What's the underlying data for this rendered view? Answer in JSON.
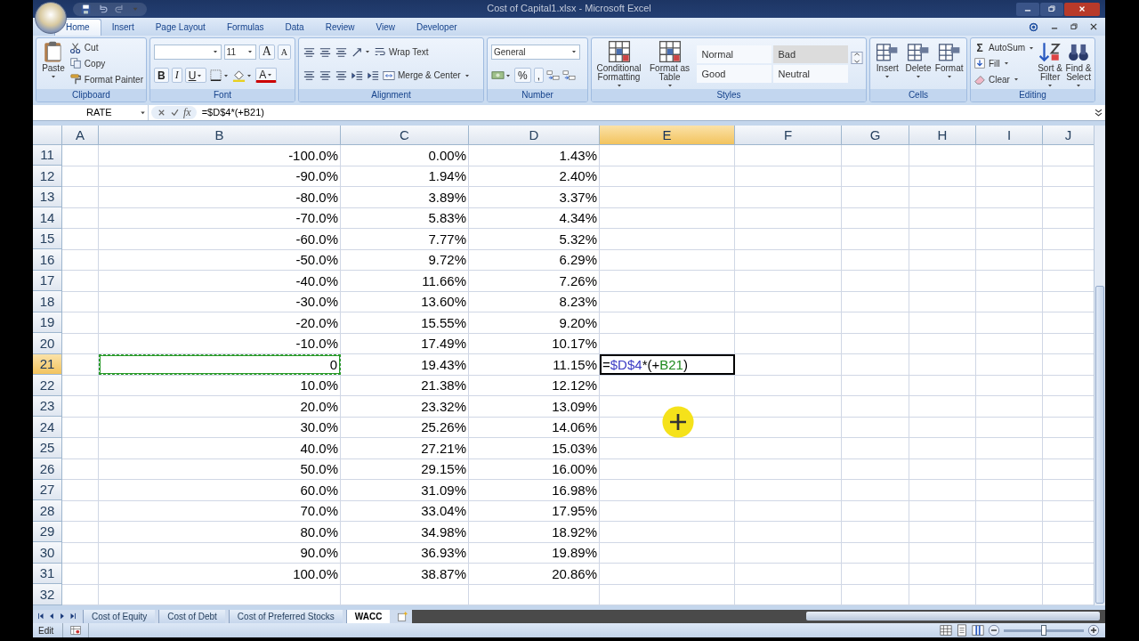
{
  "window": {
    "title": "Cost of Capital1.xlsx - Microsoft Excel"
  },
  "ribbon_tabs": [
    {
      "label": "Home",
      "selected": true
    },
    {
      "label": "Insert",
      "selected": false
    },
    {
      "label": "Page Layout",
      "selected": false
    },
    {
      "label": "Formulas",
      "selected": false
    },
    {
      "label": "Data",
      "selected": false
    },
    {
      "label": "Review",
      "selected": false
    },
    {
      "label": "View",
      "selected": false
    },
    {
      "label": "Developer",
      "selected": false
    }
  ],
  "ribbon_groups": [
    {
      "name": "Clipboard",
      "items": [
        {
          "kind": "large",
          "label": "Paste",
          "dropdown": true
        },
        {
          "kind": "small",
          "label": "Cut"
        },
        {
          "kind": "small",
          "label": "Copy"
        },
        {
          "kind": "small",
          "label": "Format Painter"
        }
      ]
    },
    {
      "name": "Font",
      "lines": [
        [
          {
            "kind": "field",
            "dropdown": true
          },
          {
            "kind": "field",
            "value": "11",
            "dropdown": true
          },
          {
            "kind": "glyph",
            "glyph": "A"
          },
          {
            "kind": "glyph",
            "glyph": "A"
          }
        ],
        [
          {
            "kind": "glyph",
            "glyph": "B"
          },
          {
            "kind": "glyph",
            "glyph": "I"
          },
          {
            "kind": "glyph",
            "glyph": "U",
            "dropdown": true
          },
          {
            "kind": "icon",
            "dropdown": true
          },
          {
            "kind": "icon",
            "dropdown": true
          },
          {
            "kind": "glyph",
            "glyph": "A",
            "dropdown": true
          }
        ]
      ]
    },
    {
      "name": "Alignment",
      "lines": [
        [
          {
            "kind": "icon"
          },
          {
            "kind": "icon"
          },
          {
            "kind": "icon"
          },
          {
            "kind": "icon",
            "dropdown": true
          },
          {
            "kind": "small",
            "label": "Wrap Text"
          }
        ],
        [
          {
            "kind": "icon"
          },
          {
            "kind": "icon"
          },
          {
            "kind": "icon"
          },
          {
            "kind": "icon"
          },
          {
            "kind": "icon"
          },
          {
            "kind": "small",
            "label": "Merge & Center",
            "dropdown": true
          }
        ]
      ]
    },
    {
      "name": "Number",
      "lines": [
        [
          {
            "kind": "field",
            "value": "General",
            "dropdown": true
          }
        ],
        [
          {
            "kind": "icon",
            "dropdown": true
          },
          {
            "kind": "glyph",
            "glyph": "%"
          },
          {
            "kind": "glyph",
            "glyph": ","
          },
          {
            "kind": "icon"
          },
          {
            "kind": "icon"
          }
        ]
      ]
    },
    {
      "name": "Styles",
      "items": [
        {
          "kind": "large",
          "label": "Conditional Formatting",
          "dropdown": true
        },
        {
          "kind": "large",
          "label": "Format as Table",
          "dropdown": true
        },
        {
          "kind": "style",
          "label": "Normal",
          "highlighted": false
        },
        {
          "kind": "style",
          "label": "Bad",
          "highlighted": true
        },
        {
          "kind": "style",
          "label": "Good",
          "highlighted": false
        },
        {
          "kind": "style",
          "label": "Neutral",
          "highlighted": false
        }
      ]
    },
    {
      "name": "Cells",
      "items": [
        {
          "kind": "large",
          "label": "Insert",
          "dropdown": true
        },
        {
          "kind": "large",
          "label": "Delete",
          "dropdown": true
        },
        {
          "kind": "large",
          "label": "Format",
          "dropdown": true
        }
      ]
    },
    {
      "name": "Editing",
      "items": [
        {
          "kind": "small",
          "label": "AutoSum",
          "glyph": "Σ",
          "dropdown": true
        },
        {
          "kind": "small",
          "label": "Fill",
          "dropdown": true
        },
        {
          "kind": "small",
          "label": "Clear",
          "dropdown": true
        },
        {
          "kind": "large",
          "label": "Sort & Filter",
          "dropdown": true
        },
        {
          "kind": "large",
          "label": "Find & Select",
          "dropdown": true
        }
      ]
    }
  ],
  "formula_bar": {
    "name_box": "RATE",
    "function_glyph": "fx",
    "formula": "=$D$4*(+B21)"
  },
  "columns": [
    {
      "label": "A",
      "selected": false
    },
    {
      "label": "B",
      "selected": false
    },
    {
      "label": "C",
      "selected": false
    },
    {
      "label": "D",
      "selected": false
    },
    {
      "label": "E",
      "selected": true
    },
    {
      "label": "F",
      "selected": false
    },
    {
      "label": "G",
      "selected": false
    },
    {
      "label": "H",
      "selected": false
    },
    {
      "label": "I",
      "selected": false
    },
    {
      "label": "J",
      "selected": false
    }
  ],
  "rows": [
    {
      "number": "11",
      "selected": false,
      "referenced": false,
      "b": "-100.0%",
      "c": "0.00%",
      "d": "1.43%"
    },
    {
      "number": "12",
      "selected": false,
      "referenced": false,
      "b": "-90.0%",
      "c": "1.94%",
      "d": "2.40%"
    },
    {
      "number": "13",
      "selected": false,
      "referenced": false,
      "b": "-80.0%",
      "c": "3.89%",
      "d": "3.37%"
    },
    {
      "number": "14",
      "selected": false,
      "referenced": false,
      "b": "-70.0%",
      "c": "5.83%",
      "d": "4.34%"
    },
    {
      "number": "15",
      "selected": false,
      "referenced": false,
      "b": "-60.0%",
      "c": "7.77%",
      "d": "5.32%"
    },
    {
      "number": "16",
      "selected": false,
      "referenced": false,
      "b": "-50.0%",
      "c": "9.72%",
      "d": "6.29%"
    },
    {
      "number": "17",
      "selected": false,
      "referenced": false,
      "b": "-40.0%",
      "c": "11.66%",
      "d": "7.26%"
    },
    {
      "number": "18",
      "selected": false,
      "referenced": false,
      "b": "-30.0%",
      "c": "13.60%",
      "d": "8.23%"
    },
    {
      "number": "19",
      "selected": false,
      "referenced": false,
      "b": "-20.0%",
      "c": "15.55%",
      "d": "9.20%"
    },
    {
      "number": "20",
      "selected": false,
      "referenced": false,
      "b": "-10.0%",
      "c": "17.49%",
      "d": "10.17%"
    },
    {
      "number": "21",
      "selected": true,
      "referenced": true,
      "b": "0",
      "c": "19.43%",
      "d": "11.15%",
      "e": [
        {
          "text": "=",
          "color": "#000000"
        },
        {
          "text": "$D$4",
          "color": "#3b3bc4"
        },
        {
          "text": "*(+",
          "color": "#000000"
        },
        {
          "text": "B21",
          "color": "#1e8a1e"
        },
        {
          "text": ")",
          "color": "#000000"
        }
      ]
    },
    {
      "number": "22",
      "selected": false,
      "referenced": false,
      "b": "10.0%",
      "c": "21.38%",
      "d": "12.12%"
    },
    {
      "number": "23",
      "selected": false,
      "referenced": false,
      "b": "20.0%",
      "c": "23.32%",
      "d": "13.09%"
    },
    {
      "number": "24",
      "selected": false,
      "referenced": false,
      "b": "30.0%",
      "c": "25.26%",
      "d": "14.06%"
    },
    {
      "number": "25",
      "selected": false,
      "referenced": false,
      "b": "40.0%",
      "c": "27.21%",
      "d": "15.03%"
    },
    {
      "number": "26",
      "selected": false,
      "referenced": false,
      "b": "50.0%",
      "c": "29.15%",
      "d": "16.00%"
    },
    {
      "number": "27",
      "selected": false,
      "referenced": false,
      "b": "60.0%",
      "c": "31.09%",
      "d": "16.98%"
    },
    {
      "number": "28",
      "selected": false,
      "referenced": false,
      "b": "70.0%",
      "c": "33.04%",
      "d": "17.95%"
    },
    {
      "number": "29",
      "selected": false,
      "referenced": false,
      "b": "80.0%",
      "c": "34.98%",
      "d": "18.92%"
    },
    {
      "number": "30",
      "selected": false,
      "referenced": false,
      "b": "90.0%",
      "c": "36.93%",
      "d": "19.89%"
    },
    {
      "number": "31",
      "selected": false,
      "referenced": false,
      "b": "100.0%",
      "c": "38.87%",
      "d": "20.86%"
    },
    {
      "number": "32",
      "selected": false,
      "referenced": false
    }
  ],
  "sheet_tabs": [
    {
      "label": "Cost of Equity",
      "selected": false
    },
    {
      "label": "Cost of Debt",
      "selected": false
    },
    {
      "label": "Cost of Preferred Stocks",
      "selected": false
    },
    {
      "label": "WACC",
      "selected": true
    }
  ],
  "status_bar": {
    "mode": "Edit",
    "zoom": {
      "level": 0.5
    }
  }
}
